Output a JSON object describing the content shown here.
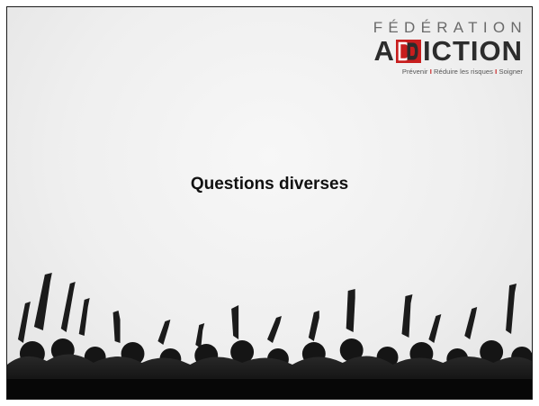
{
  "logo": {
    "top": "FÉDÉRATION",
    "word_a": "A",
    "word_rest": "ICTION",
    "tagline": [
      "Prévenir",
      "Réduire les risques",
      "Soigner"
    ],
    "colors": {
      "red": "#c71e1e",
      "dark": "#2c2c2c",
      "grey": "#6a6a6a"
    }
  },
  "slide": {
    "title": "Questions diverses"
  },
  "icons": {
    "crowd": "concert-crowd-silhouette"
  }
}
